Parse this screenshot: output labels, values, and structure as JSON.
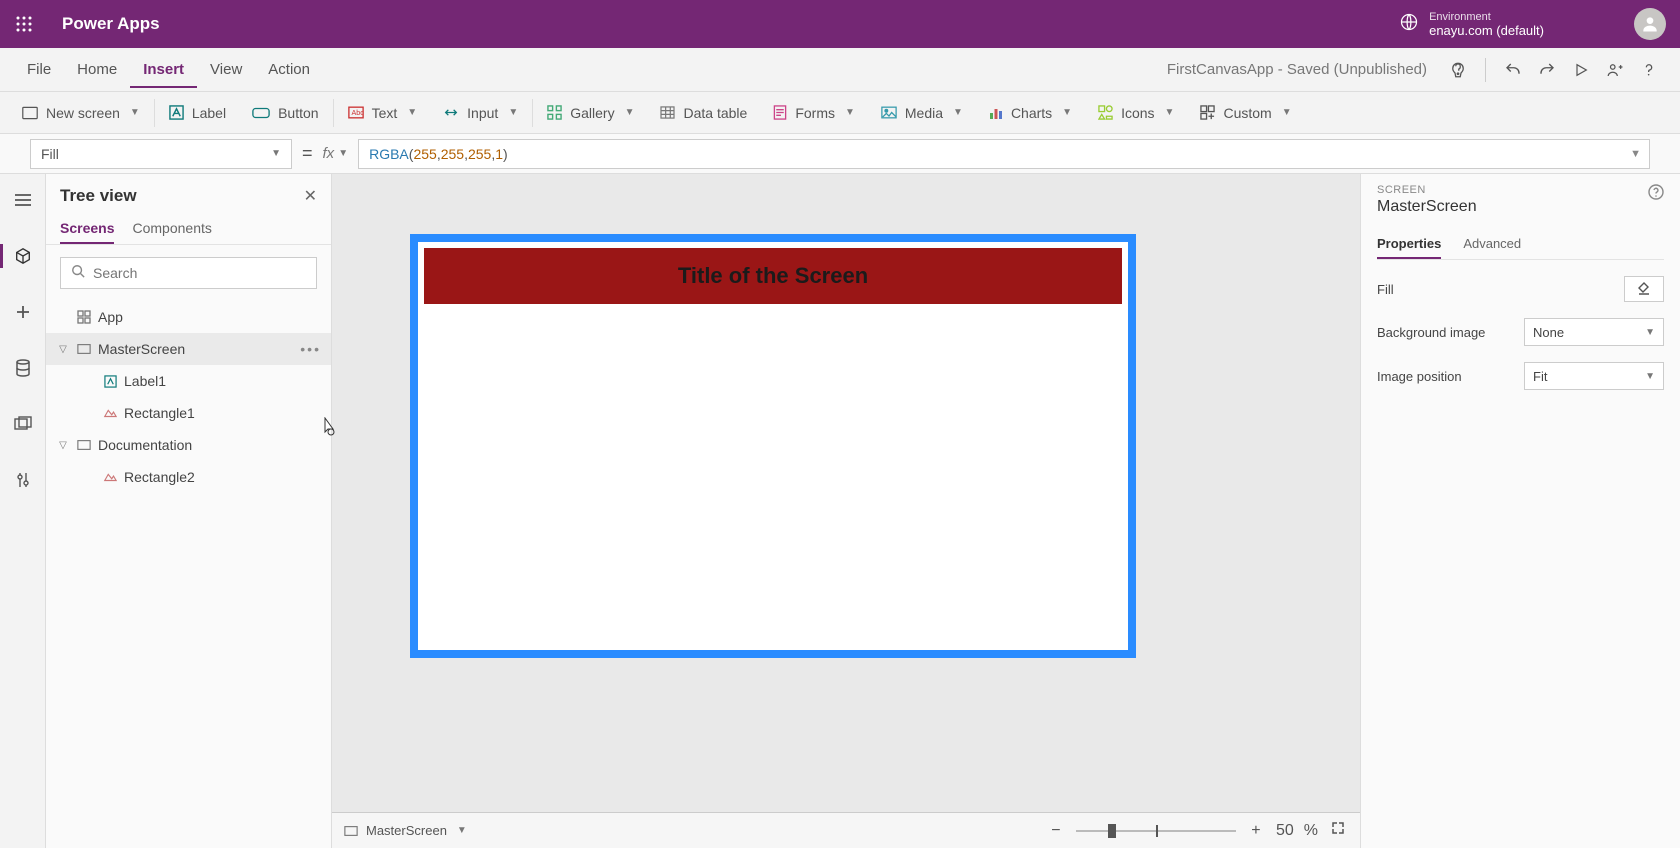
{
  "topbar": {
    "app_name": "Power Apps",
    "env_label": "Environment",
    "env_value": "enayu.com (default)"
  },
  "menubar": {
    "items": [
      "File",
      "Home",
      "Insert",
      "View",
      "Action"
    ],
    "active_index": 2,
    "doc_title": "FirstCanvasApp - Saved (Unpublished)"
  },
  "ribbon": {
    "new_screen": "New screen",
    "label": "Label",
    "button": "Button",
    "text": "Text",
    "input": "Input",
    "gallery": "Gallery",
    "data_table": "Data table",
    "forms": "Forms",
    "media": "Media",
    "charts": "Charts",
    "icons": "Icons",
    "custom": "Custom"
  },
  "formula": {
    "property": "Fill",
    "fx": "fx",
    "fn": "RGBA",
    "args": [
      "255",
      "255",
      "255",
      "1"
    ]
  },
  "tree": {
    "title": "Tree view",
    "tabs": [
      "Screens",
      "Components"
    ],
    "active_tab": 0,
    "search_placeholder": "Search",
    "app_label": "App",
    "nodes": [
      {
        "name": "MasterScreen",
        "children": [
          "Label1",
          "Rectangle1"
        ],
        "selected": true
      },
      {
        "name": "Documentation",
        "children": [
          "Rectangle2"
        ],
        "selected": false
      }
    ]
  },
  "canvas": {
    "title_text": "Title of the Screen"
  },
  "statusbar": {
    "breadcrumb": "MasterScreen",
    "zoom_value": "50",
    "zoom_unit": "%"
  },
  "proppanel": {
    "kicker": "SCREEN",
    "element": "MasterScreen",
    "tabs": [
      "Properties",
      "Advanced"
    ],
    "active_tab": 0,
    "rows": {
      "fill": "Fill",
      "bg_image": "Background image",
      "bg_image_value": "None",
      "img_pos": "Image position",
      "img_pos_value": "Fit"
    }
  }
}
